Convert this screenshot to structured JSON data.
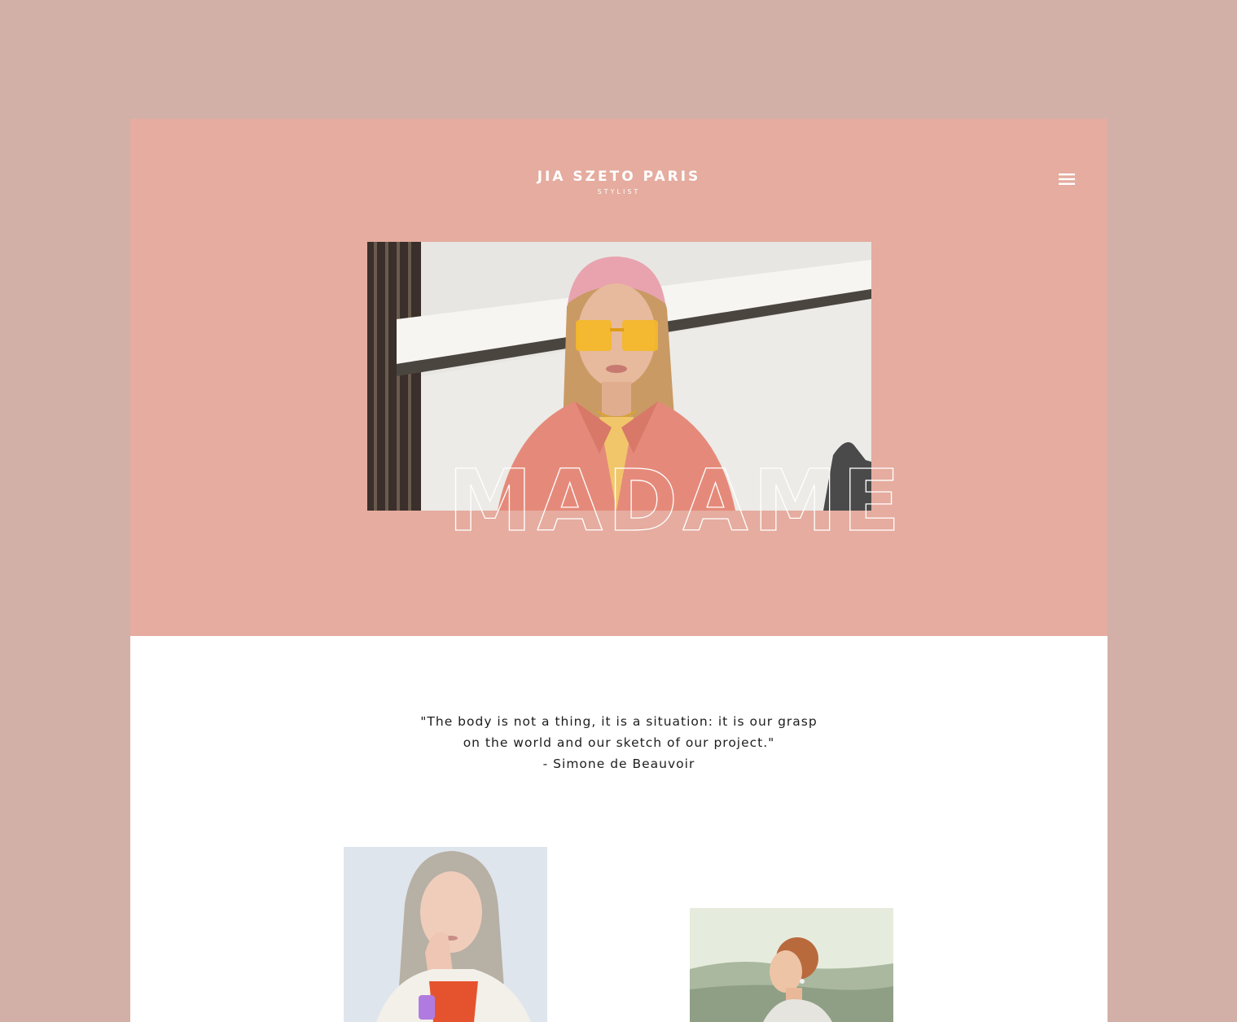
{
  "site": {
    "brand_name": "JIA SZETO PARIS",
    "tagline": "STYLIST"
  },
  "header": {
    "menu_icon": "hamburger-menu-icon"
  },
  "hero": {
    "headline": "MADAME",
    "photo": "woman-pink-headband-yellow-sunglasses-photo"
  },
  "quote": {
    "line_1": "\"The body is not a thing, it is a situation: it is our grasp",
    "line_2": "on the world and our sketch of our project.\"",
    "attribution": "- Simone de Beauvoir"
  },
  "gallery": [
    {
      "photo": "woman-silver-hair-white-jacket-photo"
    },
    {
      "photo": "woman-braided-hair-landscape-photo"
    }
  ],
  "colors": {
    "outer_background": "#d2b0a7",
    "hero_background": "#e5ac9f",
    "content_background": "#ffffff",
    "text_dark": "#1d1d1d",
    "text_light": "#ffffff"
  }
}
